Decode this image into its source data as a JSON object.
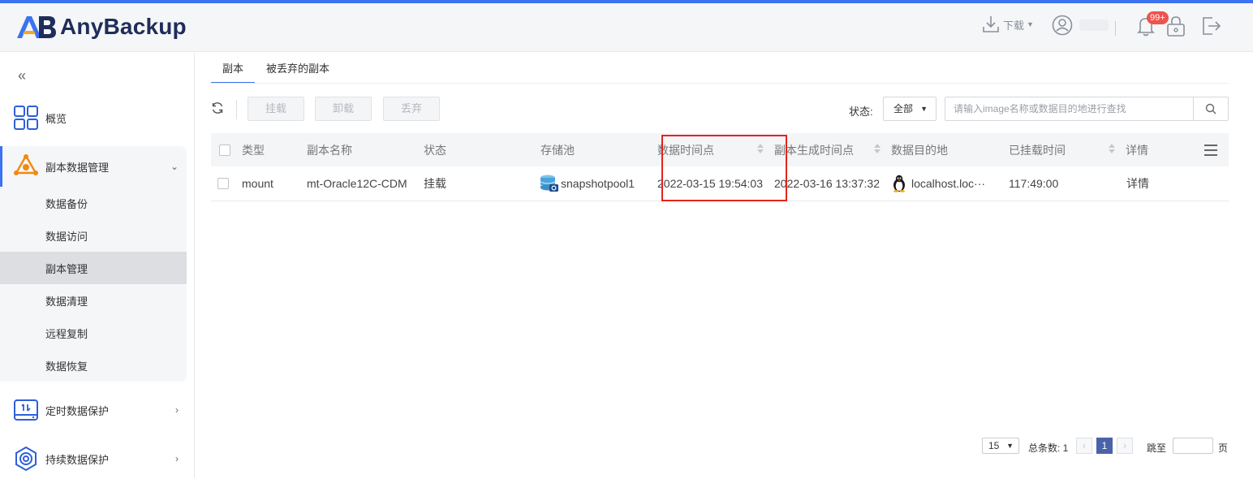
{
  "app": {
    "name": "AnyBackup"
  },
  "header": {
    "download_label": "下载",
    "notification_count": "99+"
  },
  "sidebar": {
    "collapse_glyph": "«",
    "items": [
      {
        "label": "概览",
        "icon": "grid-icon"
      },
      {
        "label": "副本数据管理",
        "icon": "copy-data-icon",
        "expanded": true
      },
      {
        "label": "定时数据保护",
        "icon": "scheduled-protect-icon"
      },
      {
        "label": "持续数据保护",
        "icon": "continuous-protect-icon"
      }
    ],
    "subitems": [
      {
        "label": "数据备份"
      },
      {
        "label": "数据访问"
      },
      {
        "label": "副本管理",
        "selected": true
      },
      {
        "label": "数据清理"
      },
      {
        "label": "远程复制"
      },
      {
        "label": "数据恢复"
      }
    ]
  },
  "tabs": [
    {
      "label": "副本",
      "active": true
    },
    {
      "label": "被丢弃的副本",
      "active": false
    }
  ],
  "toolbar": {
    "mount": "挂载",
    "unmount": "卸载",
    "discard": "丢弃",
    "status_label": "状态:",
    "status_value": "全部",
    "search_placeholder": "请输入image名称或数据目的地进行查找"
  },
  "table": {
    "columns": [
      "类型",
      "副本名称",
      "状态",
      "存储池",
      "数据时间点",
      "副本生成时间点",
      "数据目的地",
      "已挂载时间",
      "详情"
    ],
    "rows": [
      {
        "type": "mount",
        "name": "mt-Oracle12C-CDM",
        "status": "挂载",
        "pool": "snapshotpool1",
        "data_time": "2022-03-15 19:54:03",
        "created_time": "2022-03-16 13:37:32",
        "destination": "localhost.loc···",
        "mounted_time": "117:49:00",
        "detail": "详情"
      }
    ]
  },
  "pager": {
    "page_size": "15",
    "total": "总条数: 1",
    "current": "1",
    "jump_label": "跳至",
    "page_unit": "页"
  },
  "colors": {
    "accent": "#3b73f0",
    "highlight": "#e5231b",
    "badge": "#f0524c"
  }
}
